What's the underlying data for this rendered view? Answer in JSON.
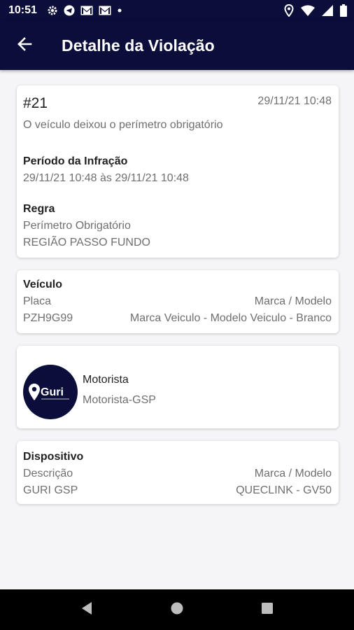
{
  "status_bar": {
    "time": "10:51",
    "icons_left": [
      "gear-icon",
      "telegram-icon",
      "gmail-icon",
      "gmail-icon",
      "dot-icon"
    ],
    "icons_right": [
      "location-icon",
      "wifi-icon",
      "signal-icon",
      "battery-icon"
    ]
  },
  "app_bar": {
    "title": "Detalhe da Violação",
    "back_icon": "arrow-left-icon",
    "background": "#0b0d3a"
  },
  "violation": {
    "number": "#21",
    "datetime": "29/11/21 10:48",
    "description": "O veículo deixou o perímetro obrigatório",
    "period_label": "Período da Infração",
    "period_value": "29/11/21 10:48 às 29/11/21 10:48",
    "rule_label": "Regra",
    "rule_name": "Perímetro Obrigatório",
    "rule_region": "REGIÃO PASSO FUNDO"
  },
  "vehicle": {
    "section_label": "Veículo",
    "plate_label": "Placa",
    "model_label": "Marca / Modelo",
    "plate_value": "PZH9G99",
    "model_value": "Marca Veiculo - Modelo Veiculo - Branco"
  },
  "driver": {
    "avatar_text": "Guri",
    "label": "Motorista",
    "name": "Motorista-GSP"
  },
  "device": {
    "section_label": "Dispositivo",
    "description_label": "Descrição",
    "model_label": "Marca / Modelo",
    "description_value": "GURI GSP",
    "model_value": "QUECLINK - GV50"
  },
  "nav_bar": {
    "buttons": [
      "back-triangle-icon",
      "home-circle-icon",
      "recents-square-icon"
    ]
  }
}
